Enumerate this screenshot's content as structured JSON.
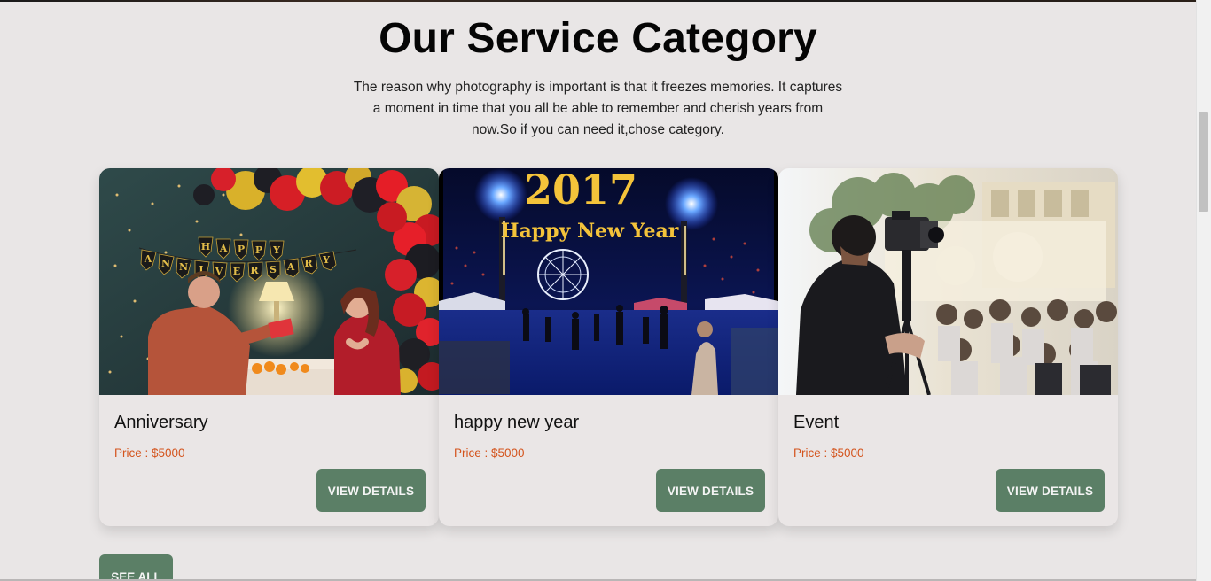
{
  "section": {
    "title": "Our Service Category",
    "description": "The reason why photography is important is that it freezes memories. It captures a moment in time that you all be able to remember and cherish years from now.So if you can need it,chose category."
  },
  "cards": [
    {
      "title": "Anniversary",
      "price": "Price : $5000",
      "button": "VIEW DETAILS",
      "image_banner": [
        "H",
        "A",
        "P",
        "P",
        "Y",
        "A",
        "N",
        "N",
        "I",
        "V",
        "E",
        "R",
        "S",
        "A",
        "R",
        "Y"
      ]
    },
    {
      "title": "happy new year",
      "price": "Price : $5000",
      "button": "VIEW DETAILS",
      "image_year": "2017",
      "image_caption": "Happy New Year"
    },
    {
      "title": "Event",
      "price": "Price : $5000",
      "button": "VIEW DETAILS"
    }
  ],
  "see_all": "SEE ALL",
  "colors": {
    "background": "#e9e6e6",
    "button": "#5b7f66",
    "price": "#d4541d"
  }
}
